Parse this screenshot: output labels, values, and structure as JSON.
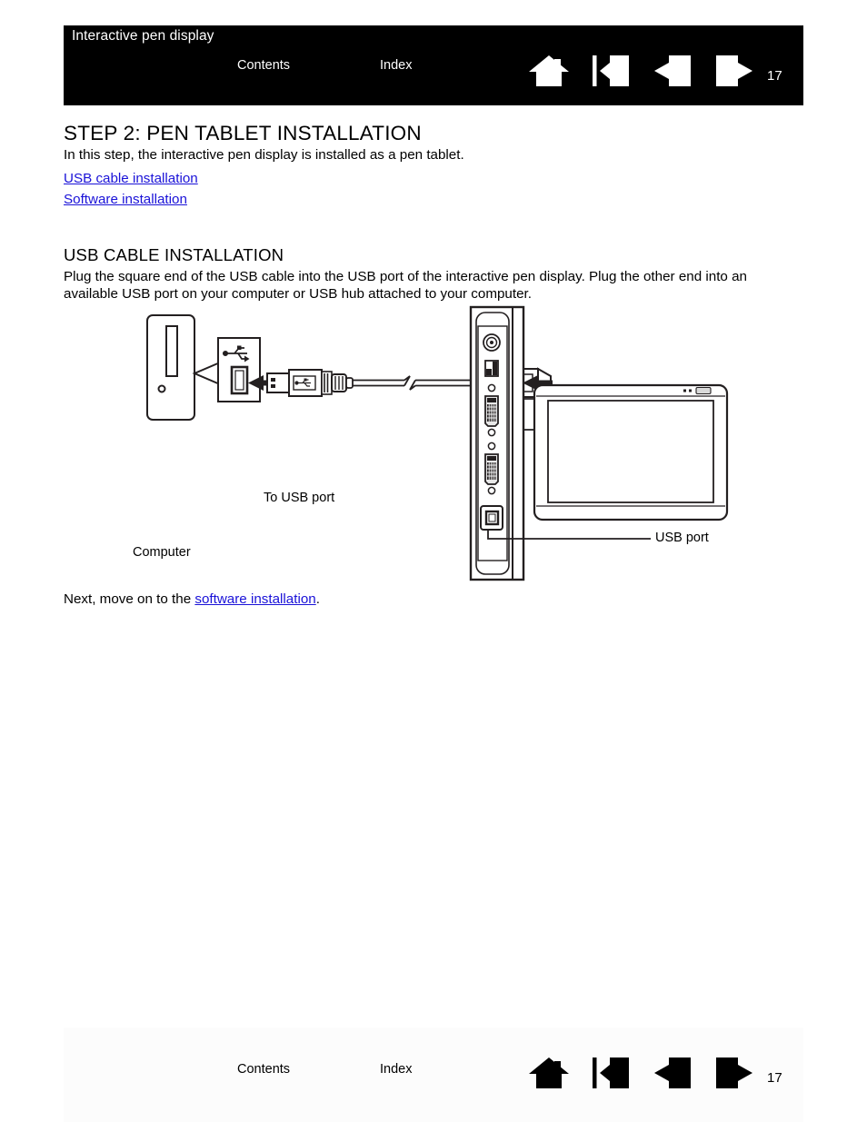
{
  "header": {
    "title": "Interactive pen display",
    "contents_label": "Contents",
    "index_label": "Index",
    "page_number": "17",
    "nav": [
      {
        "name": "home-icon",
        "label": "Home"
      },
      {
        "name": "go-to-start-icon",
        "label": "Go to start"
      },
      {
        "name": "previous-page-icon",
        "label": "Previous page"
      },
      {
        "name": "next-page-icon",
        "label": "Next page"
      }
    ],
    "bg_color": "#000000",
    "fg_color": "#ffffff"
  },
  "content": {
    "step_title": "STEP 2: PEN TABLET INSTALLATION",
    "step_intro": "In this step, the interactive pen display is installed as a pen tablet.",
    "toc_links": [
      "USB cable installation",
      "Software installation"
    ],
    "section_title": "USB CABLE INSTALLATION",
    "section_paragraph": "Plug the square end of the USB cable into the USB port of the interactive pen display.  Plug the other end into an available USB port on your computer or USB hub attached to your computer.",
    "next_prefix": "Next, move on to the ",
    "next_link": "software installation",
    "next_suffix": ".",
    "link_color": "#1a12d8"
  },
  "diagram": {
    "labels": {
      "computer": "Computer",
      "to_usb_port": "To USB port",
      "usb_port": "USB port"
    },
    "parts": [
      "computer-tower",
      "usb-port-callout",
      "usb-cable",
      "pen-display-connector-panel",
      "pen-display-screen"
    ]
  },
  "footer": {
    "contents_label": "Contents",
    "index_label": "Index",
    "page_number": "17",
    "nav": [
      {
        "name": "home-icon",
        "label": "Home"
      },
      {
        "name": "go-to-start-icon",
        "label": "Go to start"
      },
      {
        "name": "previous-page-icon",
        "label": "Previous page"
      },
      {
        "name": "next-page-icon",
        "label": "Next page"
      }
    ],
    "fg_color": "#000000"
  }
}
